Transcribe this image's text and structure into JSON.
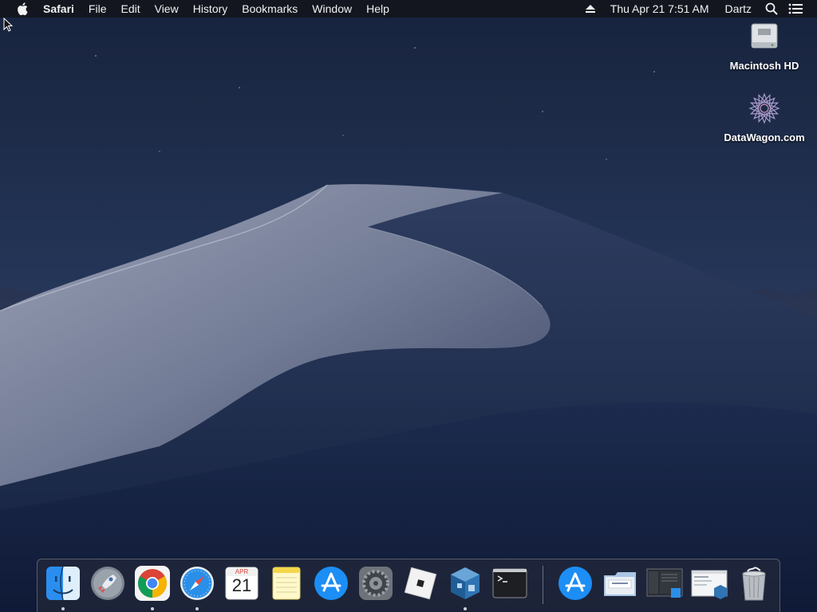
{
  "menubar": {
    "app_name": "Safari",
    "menus": [
      "File",
      "Edit",
      "View",
      "History",
      "Bookmarks",
      "Window",
      "Help"
    ],
    "clock": "Thu Apr 21  7:51 AM",
    "user": "Dartz"
  },
  "desktop": {
    "icons": [
      {
        "label": "Macintosh HD",
        "icon": "hard-drive-icon"
      },
      {
        "label": "DataWagon.com",
        "icon": "datawagon-logo-icon"
      }
    ]
  },
  "dock": {
    "apps": [
      {
        "name": "Finder",
        "icon": "finder-icon",
        "running": true
      },
      {
        "name": "Launchpad",
        "icon": "launchpad-icon",
        "running": false
      },
      {
        "name": "Google Chrome",
        "icon": "chrome-icon",
        "running": true
      },
      {
        "name": "Safari",
        "icon": "safari-icon",
        "running": true
      },
      {
        "name": "Calendar",
        "icon": "calendar-icon",
        "running": false,
        "month": "APR",
        "day": "21"
      },
      {
        "name": "Notes",
        "icon": "notes-icon",
        "running": false
      },
      {
        "name": "App Store",
        "icon": "app-store-icon",
        "running": false
      },
      {
        "name": "System Preferences",
        "icon": "system-preferences-icon",
        "running": false
      },
      {
        "name": "Roblox",
        "icon": "roblox-icon",
        "running": false
      },
      {
        "name": "VirtualBox",
        "icon": "virtualbox-icon",
        "running": true
      },
      {
        "name": "Terminal",
        "icon": "terminal-icon",
        "running": false
      }
    ],
    "others": [
      {
        "name": "App Store Downloads",
        "icon": "app-store-folder-icon"
      },
      {
        "name": "Documents",
        "icon": "documents-stack-icon"
      },
      {
        "name": "Screenshot",
        "icon": "screenshot-stack-icon"
      },
      {
        "name": "VirtualBox Window",
        "icon": "minimized-window-icon"
      },
      {
        "name": "Trash",
        "icon": "trash-icon"
      }
    ]
  },
  "colors": {
    "menubar_bg": "#14161c",
    "sky_top": "#1b2a47",
    "sky_bottom": "#2c3e62",
    "dune_light": "#8c93a8",
    "dune_dark": "#1d2b4d"
  }
}
